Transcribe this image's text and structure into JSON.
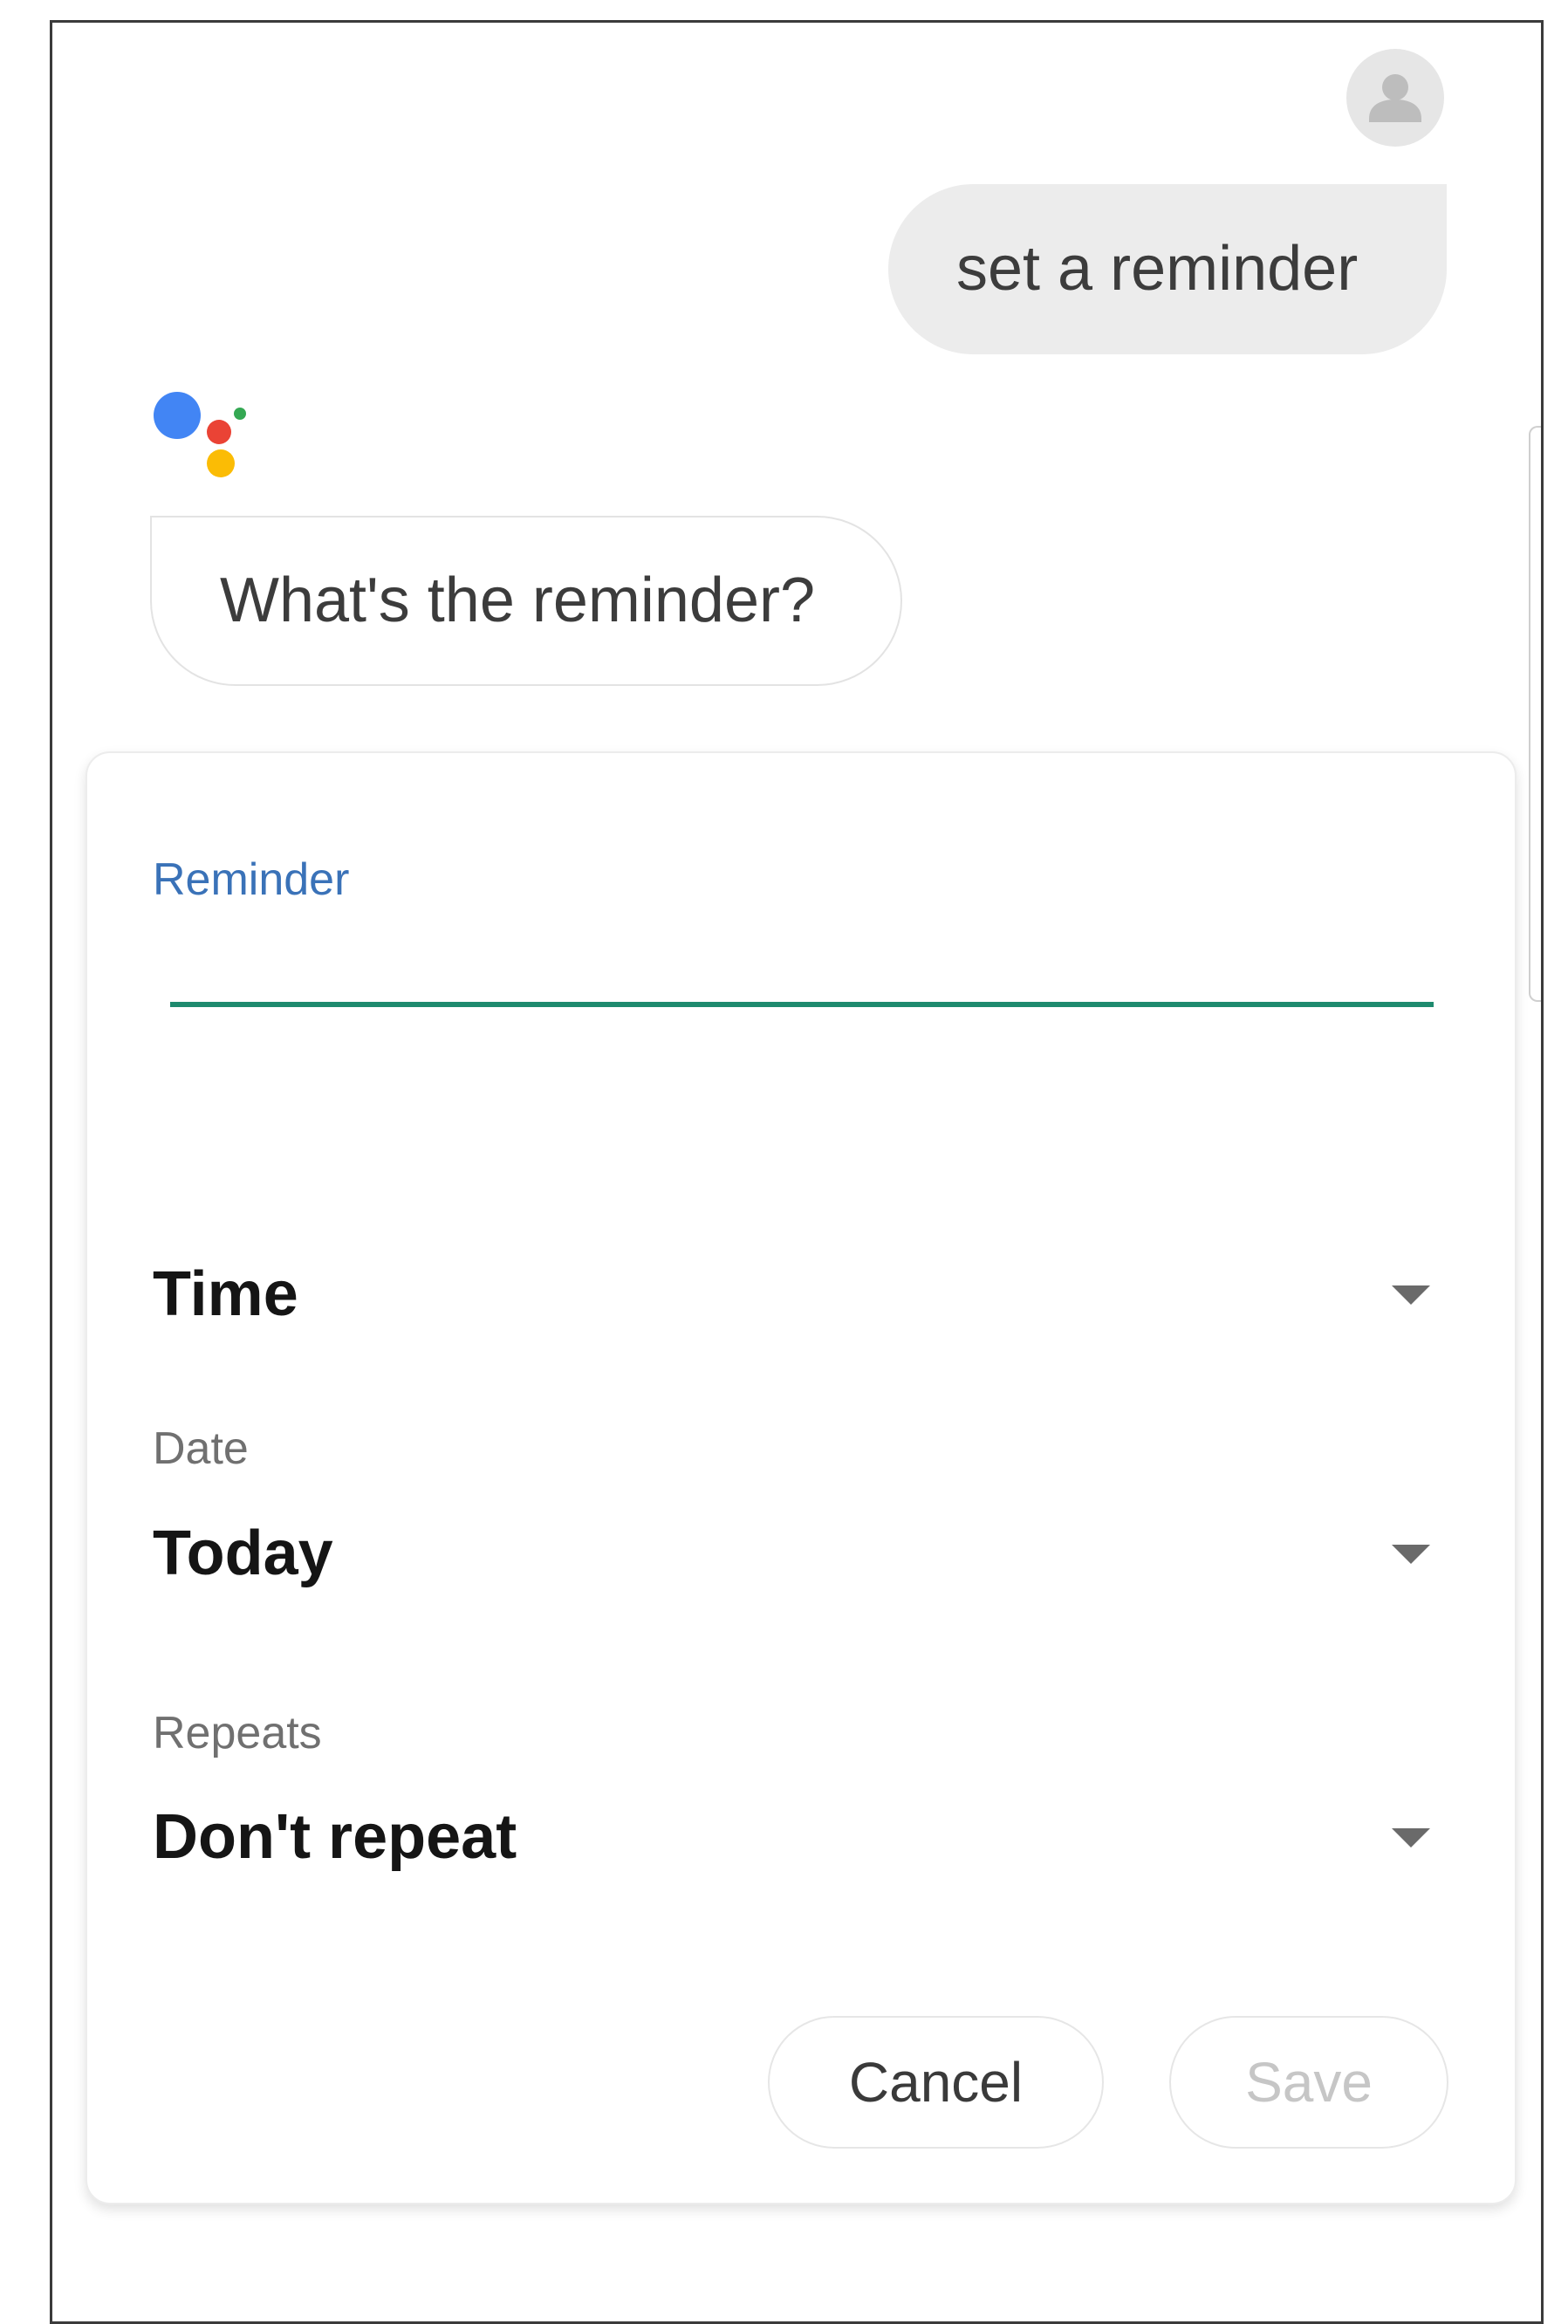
{
  "conversation": {
    "user_message": "set a reminder",
    "assistant_message": "What's the reminder?"
  },
  "reminder_card": {
    "reminder_label": "Reminder",
    "reminder_value": "",
    "time_value": "Time",
    "date_label": "Date",
    "date_value": "Today",
    "repeats_label": "Repeats",
    "repeats_value": "Don't repeat",
    "cancel_label": "Cancel",
    "save_label": "Save"
  },
  "icons": {
    "avatar": "person-icon",
    "assistant": "google-assistant-icon",
    "dropdown": "dropdown-caret-icon"
  },
  "colors": {
    "accent_label": "#3a72b8",
    "input_underline": "#1e8a6e",
    "assistant_blue": "#4285f4",
    "assistant_red": "#ea4335",
    "assistant_yellow": "#fbbc05",
    "assistant_green": "#34a853"
  }
}
